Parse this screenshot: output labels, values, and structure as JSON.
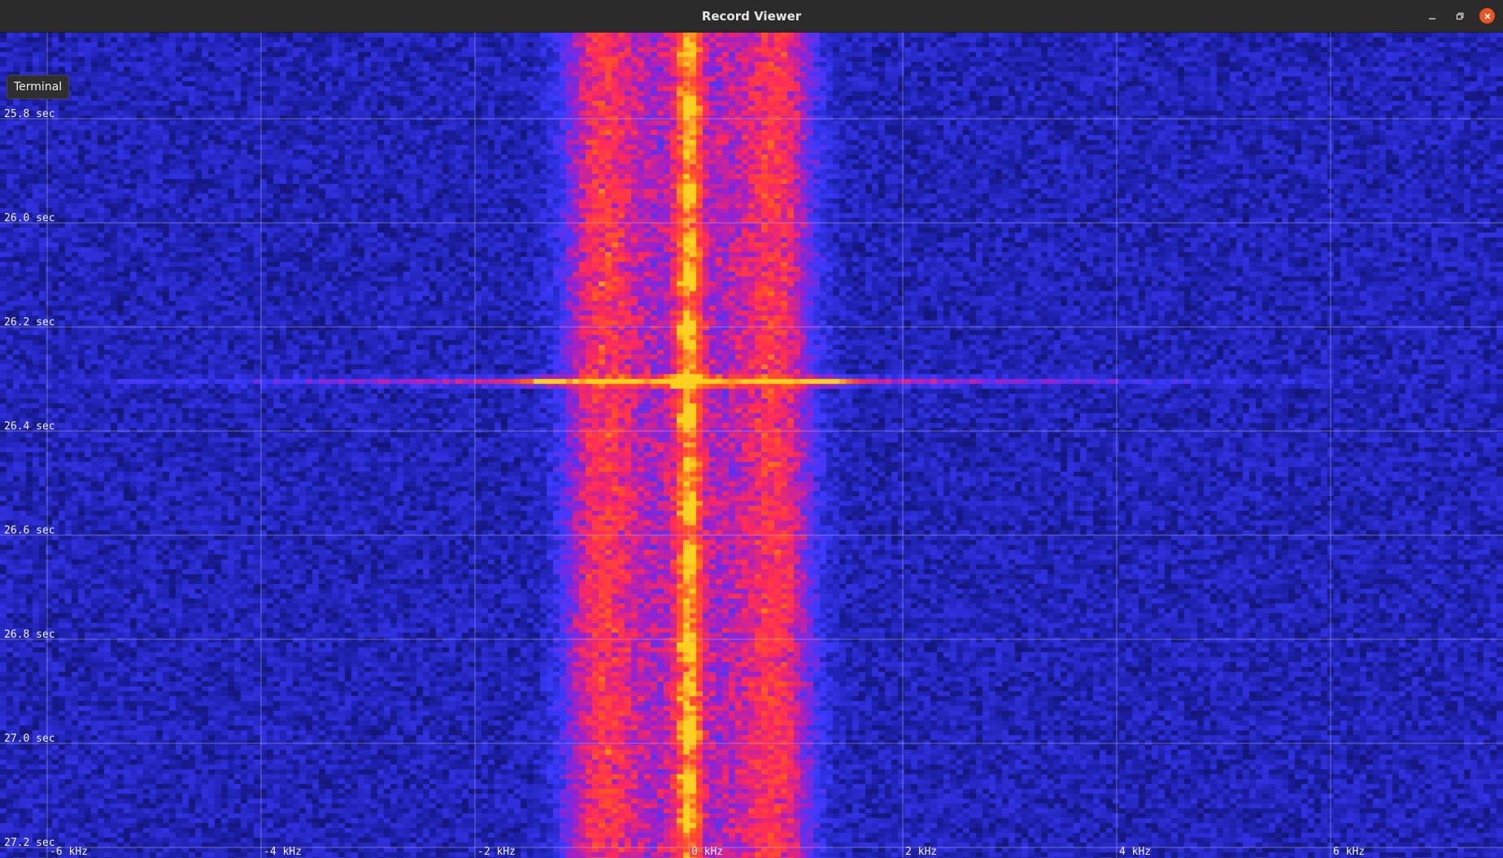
{
  "window": {
    "title": "Record Viewer",
    "controls": {
      "minimize_icon": "minimize-icon",
      "maximize_icon": "restore-icon",
      "close_icon": "close-icon",
      "close_color": "#e95420"
    }
  },
  "tooltip": {
    "text": "Terminal"
  },
  "spectrogram": {
    "colormap": [
      "#000000",
      "#1c1fa6",
      "#3b3bff",
      "#a020c8",
      "#ff2a5a",
      "#ff5a1f",
      "#ffd21a"
    ],
    "time_labels": [
      "25.8 sec",
      "26.0 sec",
      "26.2 sec",
      "26.4 sec",
      "26.6 sec",
      "26.8 sec",
      "27.0 sec",
      "27.2 sec"
    ],
    "freq_labels": [
      "-6 kHz",
      "-4 kHz",
      "-2 kHz",
      "0 kHz",
      "2 kHz",
      "4 kHz",
      "6 kHz"
    ],
    "time_values_sec": [
      25.8,
      26.0,
      26.2,
      26.4,
      26.6,
      26.8,
      27.0,
      27.2
    ],
    "freq_values_khz": [
      -6,
      -4,
      -2,
      0,
      2,
      4,
      6
    ],
    "grid": true
  }
}
